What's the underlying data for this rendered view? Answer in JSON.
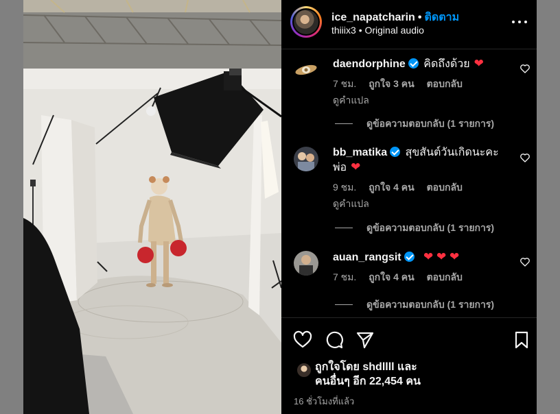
{
  "post": {
    "username": "ice_napatcharin",
    "separator": "•",
    "follow_label": "ติดตาม",
    "audio_user": "thiiix3",
    "audio_separator": "•",
    "audio_label": "Original audio"
  },
  "comments": [
    {
      "username": "daendorphine",
      "text": "คิดถึงด้วย",
      "emoji": "❤",
      "time": "7 ชม.",
      "likes": "ถูกใจ 3 คน",
      "reply": "ตอบกลับ",
      "translate": "ดูคำแปล",
      "view_replies": "ดูข้อความตอบกลับ (1 รายการ)"
    },
    {
      "username": "bb_matika",
      "text": "สุขสันต์วันเกิดนะคะ",
      "text2": "พ่อ",
      "emoji": "❤",
      "time": "9 ชม.",
      "likes": "ถูกใจ 4 คน",
      "reply": "ตอบกลับ",
      "translate": "ดูคำแปล",
      "view_replies": "ดูข้อความตอบกลับ (1 รายการ)"
    },
    {
      "username": "auan_rangsit",
      "emoji": "❤ ❤ ❤",
      "time": "7 ชม.",
      "likes": "ถูกใจ 4 คน",
      "reply": "ตอบกลับ",
      "view_replies": "ดูข้อความตอบกลับ (1 รายการ)"
    }
  ],
  "likes": {
    "line1": "ถูกใจโดย shdllll และ",
    "line2": "คนอื่นๆ อีก 22,454 คน"
  },
  "posted_time": "16 ชั่วโมงที่แล้ว",
  "colors": {
    "follow_blue": "#0095f6",
    "heart_red": "#ff3040",
    "muted_text": "#a8a8a8"
  },
  "icons": [
    "more-options-icon",
    "verified-badge-icon",
    "heart-outline-icon",
    "comment-icon",
    "share-icon",
    "bookmark-icon"
  ]
}
